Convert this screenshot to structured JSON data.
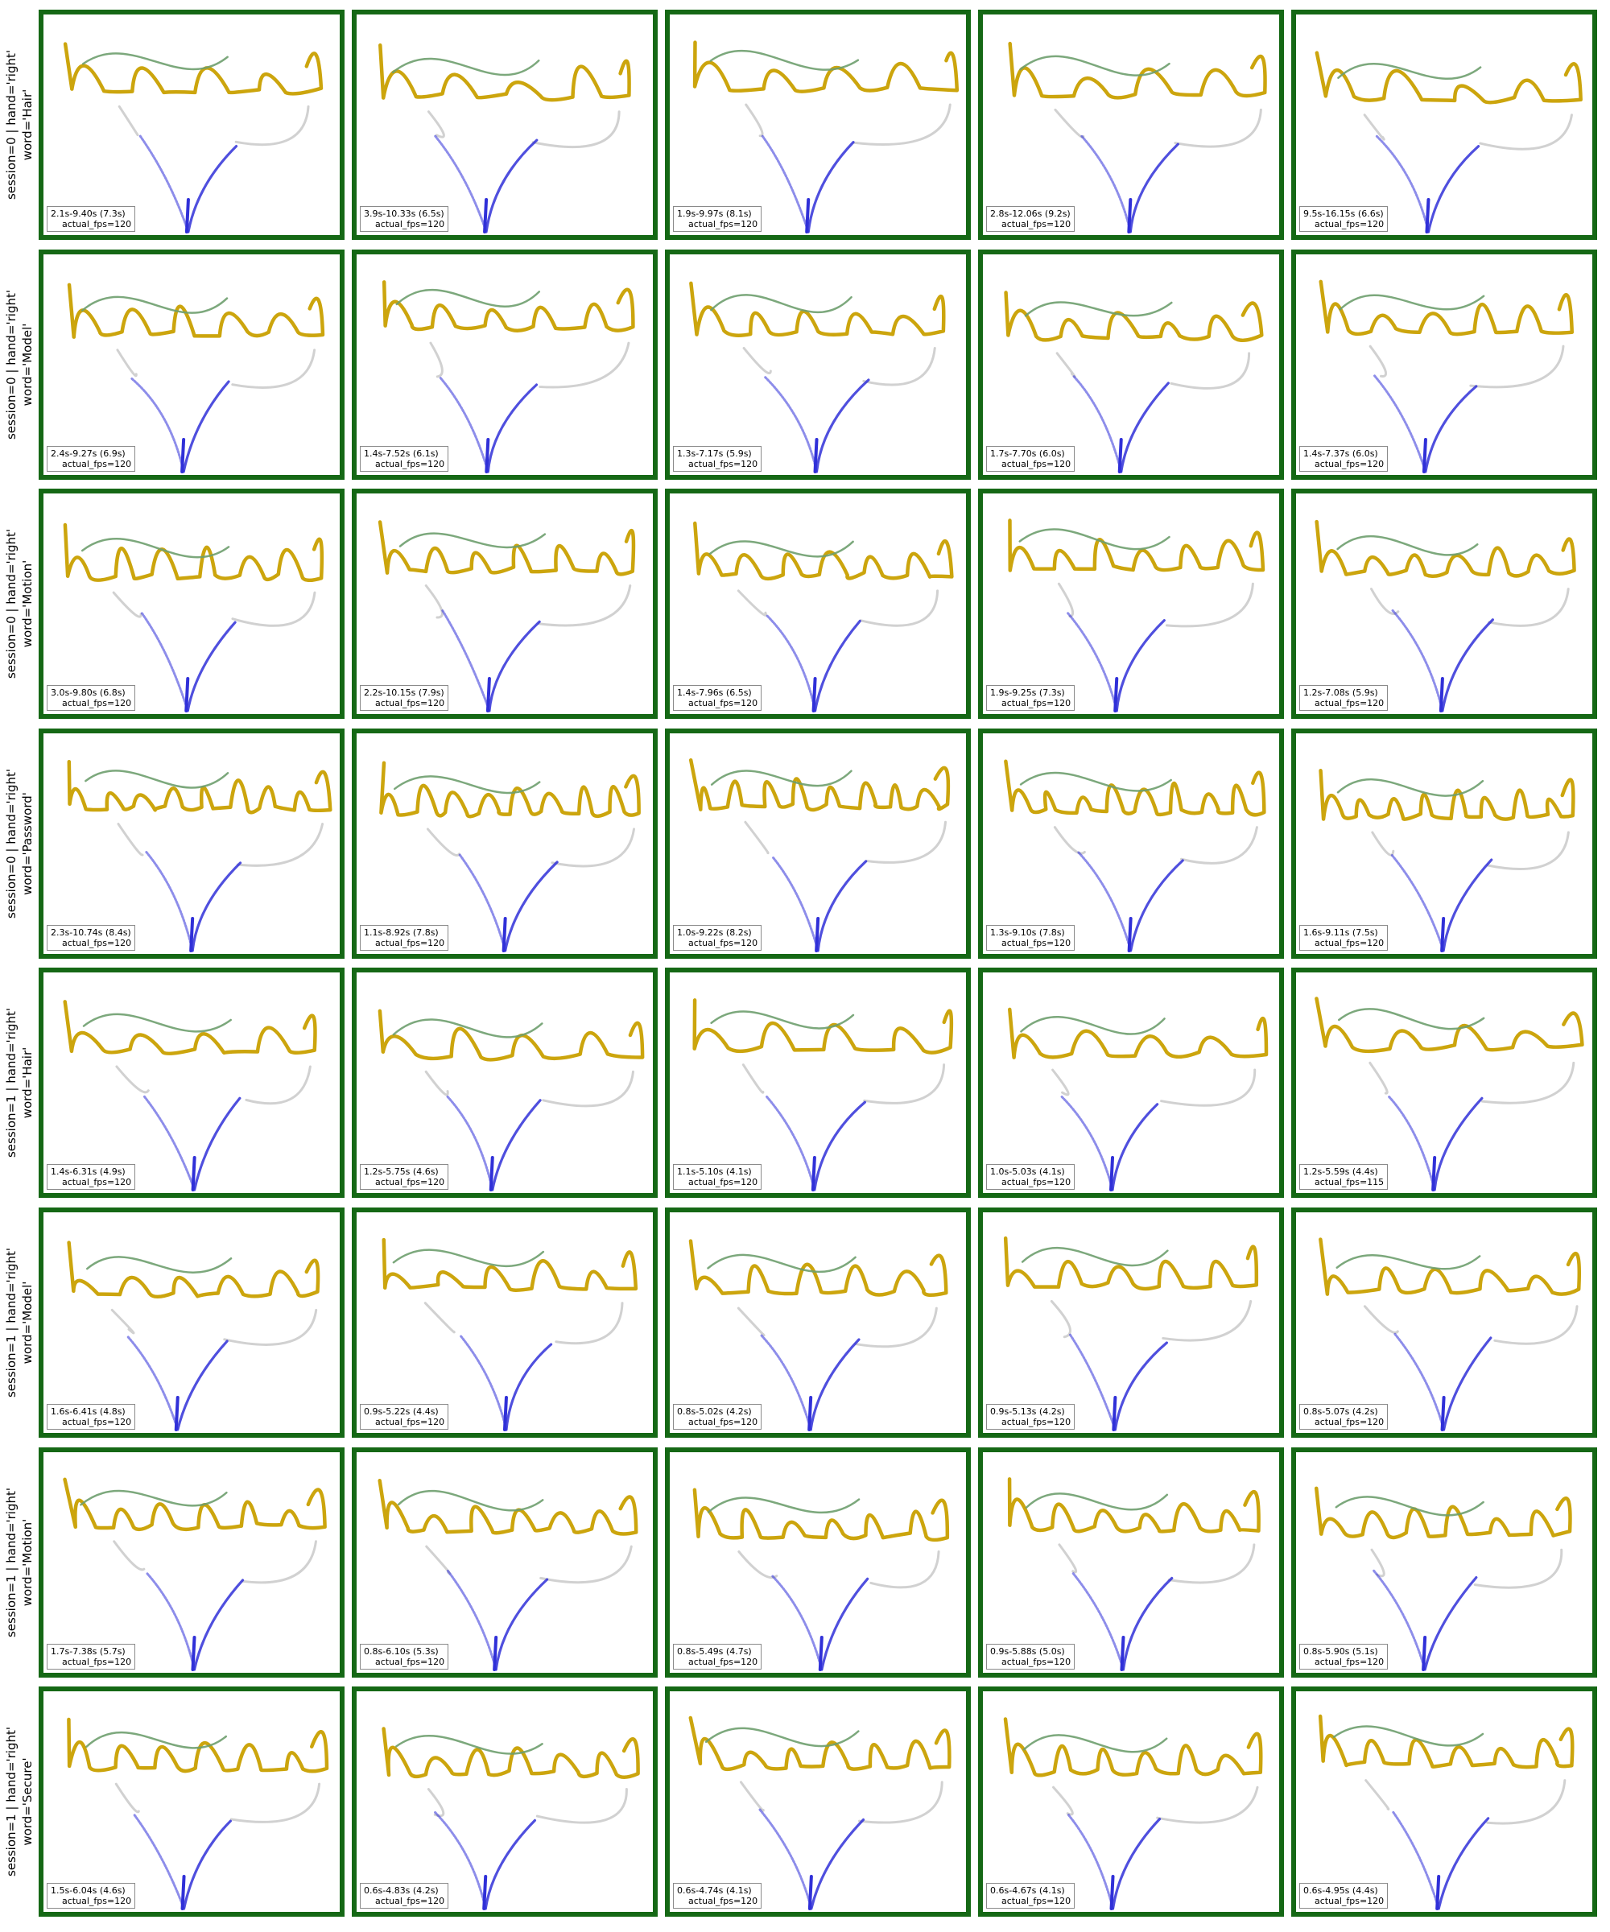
{
  "chart_data": {
    "type": "grid of handwriting trajectory plots",
    "colors": {
      "panel_border": "#156815",
      "writing_stroke": "#C9A000",
      "pen_lift_stroke": "#6E9E6E",
      "approach_stroke": "#3030D8",
      "transition_stroke": "#BDBDBD",
      "tag_border": "#8a8a8a"
    },
    "rows": [
      {
        "label": "session=0 | hand='right'\nword='Hair'",
        "word": "Hair",
        "panels": [
          {
            "time": "2.1s-9.40s (7.3s)",
            "fps": "actual_fps=120"
          },
          {
            "time": "3.9s-10.33s (6.5s)",
            "fps": "actual_fps=120"
          },
          {
            "time": "1.9s-9.97s (8.1s)",
            "fps": "actual_fps=120"
          },
          {
            "time": "2.8s-12.06s (9.2s)",
            "fps": "actual_fps=120"
          },
          {
            "time": "9.5s-16.15s (6.6s)",
            "fps": "actual_fps=120"
          }
        ]
      },
      {
        "label": "session=0 | hand='right'\nword='Model'",
        "word": "Model",
        "panels": [
          {
            "time": "2.4s-9.27s (6.9s)",
            "fps": "actual_fps=120"
          },
          {
            "time": "1.4s-7.52s (6.1s)",
            "fps": "actual_fps=120"
          },
          {
            "time": "1.3s-7.17s (5.9s)",
            "fps": "actual_fps=120"
          },
          {
            "time": "1.7s-7.70s (6.0s)",
            "fps": "actual_fps=120"
          },
          {
            "time": "1.4s-7.37s (6.0s)",
            "fps": "actual_fps=120"
          }
        ]
      },
      {
        "label": "session=0 | hand='right'\nword='Motion'",
        "word": "Motion",
        "panels": [
          {
            "time": "3.0s-9.80s (6.8s)",
            "fps": "actual_fps=120"
          },
          {
            "time": "2.2s-10.15s (7.9s)",
            "fps": "actual_fps=120"
          },
          {
            "time": "1.4s-7.96s (6.5s)",
            "fps": "actual_fps=120"
          },
          {
            "time": "1.9s-9.25s (7.3s)",
            "fps": "actual_fps=120"
          },
          {
            "time": "1.2s-7.08s (5.9s)",
            "fps": "actual_fps=120"
          }
        ]
      },
      {
        "label": "session=0 | hand='right'\nword='Password'",
        "word": "Password",
        "panels": [
          {
            "time": "2.3s-10.74s (8.4s)",
            "fps": "actual_fps=120"
          },
          {
            "time": "1.1s-8.92s (7.8s)",
            "fps": "actual_fps=120"
          },
          {
            "time": "1.0s-9.22s (8.2s)",
            "fps": "actual_fps=120"
          },
          {
            "time": "1.3s-9.10s (7.8s)",
            "fps": "actual_fps=120"
          },
          {
            "time": "1.6s-9.11s (7.5s)",
            "fps": "actual_fps=120"
          }
        ]
      },
      {
        "label": "session=1 | hand='right'\nword='Hair'",
        "word": "Hair",
        "panels": [
          {
            "time": "1.4s-6.31s (4.9s)",
            "fps": "actual_fps=120"
          },
          {
            "time": "1.2s-5.75s (4.6s)",
            "fps": "actual_fps=120"
          },
          {
            "time": "1.1s-5.10s (4.1s)",
            "fps": "actual_fps=120"
          },
          {
            "time": "1.0s-5.03s (4.1s)",
            "fps": "actual_fps=120"
          },
          {
            "time": "1.2s-5.59s (4.4s)",
            "fps": "actual_fps=115"
          }
        ]
      },
      {
        "label": "session=1 | hand='right'\nword='Model'",
        "word": "Model",
        "panels": [
          {
            "time": "1.6s-6.41s (4.8s)",
            "fps": "actual_fps=120"
          },
          {
            "time": "0.9s-5.22s (4.4s)",
            "fps": "actual_fps=120"
          },
          {
            "time": "0.8s-5.02s (4.2s)",
            "fps": "actual_fps=120"
          },
          {
            "time": "0.9s-5.13s (4.2s)",
            "fps": "actual_fps=120"
          },
          {
            "time": "0.8s-5.07s (4.2s)",
            "fps": "actual_fps=120"
          }
        ]
      },
      {
        "label": "session=1 | hand='right'\nword='Motion'",
        "word": "Motion",
        "panels": [
          {
            "time": "1.7s-7.38s (5.7s)",
            "fps": "actual_fps=120"
          },
          {
            "time": "0.8s-6.10s (5.3s)",
            "fps": "actual_fps=120"
          },
          {
            "time": "0.8s-5.49s (4.7s)",
            "fps": "actual_fps=120"
          },
          {
            "time": "0.9s-5.88s (5.0s)",
            "fps": "actual_fps=120"
          },
          {
            "time": "0.8s-5.90s (5.1s)",
            "fps": "actual_fps=120"
          }
        ]
      },
      {
        "label": "session=1 | hand='right'\nword='Secure'",
        "word": "Secure",
        "panels": [
          {
            "time": "1.5s-6.04s (4.6s)",
            "fps": "actual_fps=120"
          },
          {
            "time": "0.6s-4.83s (4.2s)",
            "fps": "actual_fps=120"
          },
          {
            "time": "0.6s-4.74s (4.1s)",
            "fps": "actual_fps=120"
          },
          {
            "time": "0.6s-4.67s (4.1s)",
            "fps": "actual_fps=120"
          },
          {
            "time": "0.6s-4.95s (4.4s)",
            "fps": "actual_fps=120"
          }
        ]
      }
    ]
  }
}
